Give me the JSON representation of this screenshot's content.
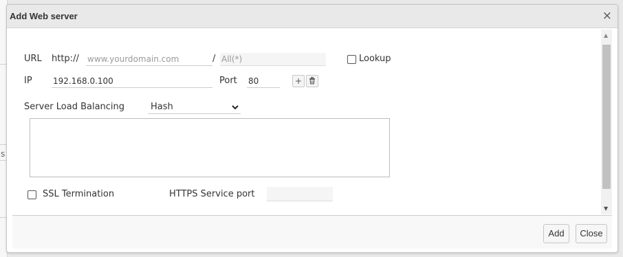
{
  "background": {
    "edge_char": "s"
  },
  "dialog": {
    "title": "Add Web server",
    "close_glyph": "×"
  },
  "form": {
    "url_label": "URL",
    "url_scheme": "http://",
    "domain_placeholder": "www.yourdomain.com",
    "path_separator": "/",
    "path_placeholder": "All(*)",
    "lookup_label": "Lookup",
    "ip_label": "IP",
    "ip_value": "192.168.0.100",
    "port_label": "Port",
    "port_value": "80",
    "add_icon": "+",
    "lb_label": "Server Load Balancing",
    "lb_selected": "Hash",
    "ssl_label": "SSL Termination",
    "https_port_label": "HTTPS Service port",
    "https_port_value": ""
  },
  "footer": {
    "add_label": "Add",
    "close_label": "Close"
  },
  "colors": {
    "titlebar": "#e9e9e9",
    "border": "#c5c5c5",
    "scroll_thumb": "#c1c1c1"
  }
}
